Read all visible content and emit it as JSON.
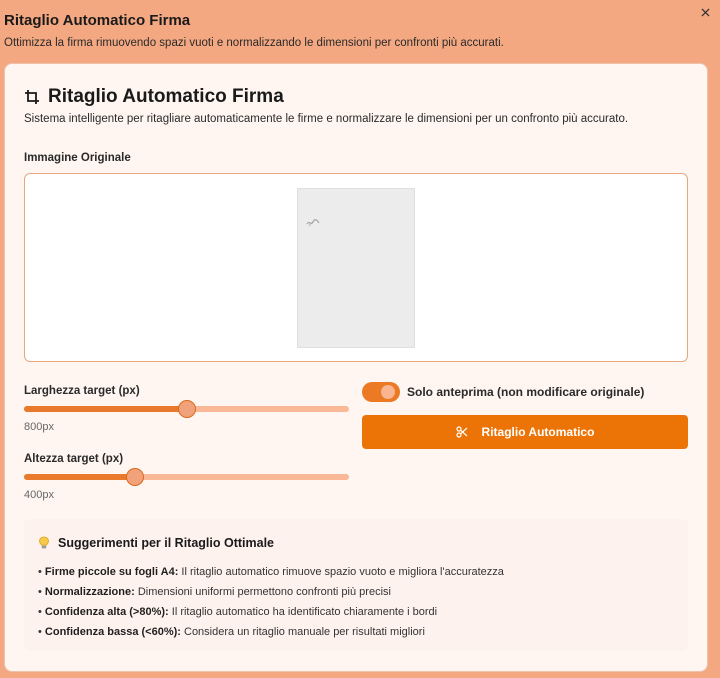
{
  "dialog": {
    "title": "Ritaglio Automatico Firma",
    "subtitle": "Ottimizza la firma rimuovendo spazi vuoti e normalizzando le dimensioni per confronti più accurati.",
    "close_icon": "close-icon"
  },
  "card": {
    "title": "Ritaglio Automatico Firma",
    "description": "Sistema intelligente per ritagliare automaticamente le firme e normalizzare le dimensioni per un confronto più accurato.",
    "icon": "crop-icon"
  },
  "original_image": {
    "label": "Immagine Originale"
  },
  "width_slider": {
    "label": "Larghezza target (px)",
    "value_text": "800px",
    "level": 0.5
  },
  "height_slider": {
    "label": "Altezza target (px)",
    "value_text": "400px",
    "level": 0.34
  },
  "preview_toggle": {
    "label": "Solo anteprima (non modificare originale)",
    "checked": true
  },
  "auto_crop_button": {
    "label": "Ritaglio Automatico",
    "icon": "scissors-icon"
  },
  "tips": {
    "icon": "lightbulb-icon",
    "title": "Suggerimenti per il Ritaglio Ottimale",
    "items": [
      {
        "bold": "Firme piccole su fogli A4:",
        "text": " Il ritaglio automatico rimuove spazio vuoto e migliora l'accuratezza"
      },
      {
        "bold": "Normalizzazione:",
        "text": " Dimensioni uniformi permettono confronti più precisi"
      },
      {
        "bold": "Confidenza alta (>80%):",
        "text": " Il ritaglio automatico ha identificato chiaramente i bordi"
      },
      {
        "bold": "Confidenza bassa (<60%):",
        "text": " Considera un ritaglio manuale per risultati migliori"
      }
    ]
  },
  "colors": {
    "accent": "#ec7406",
    "background": "#f4a882",
    "card": "#fff6f2"
  }
}
